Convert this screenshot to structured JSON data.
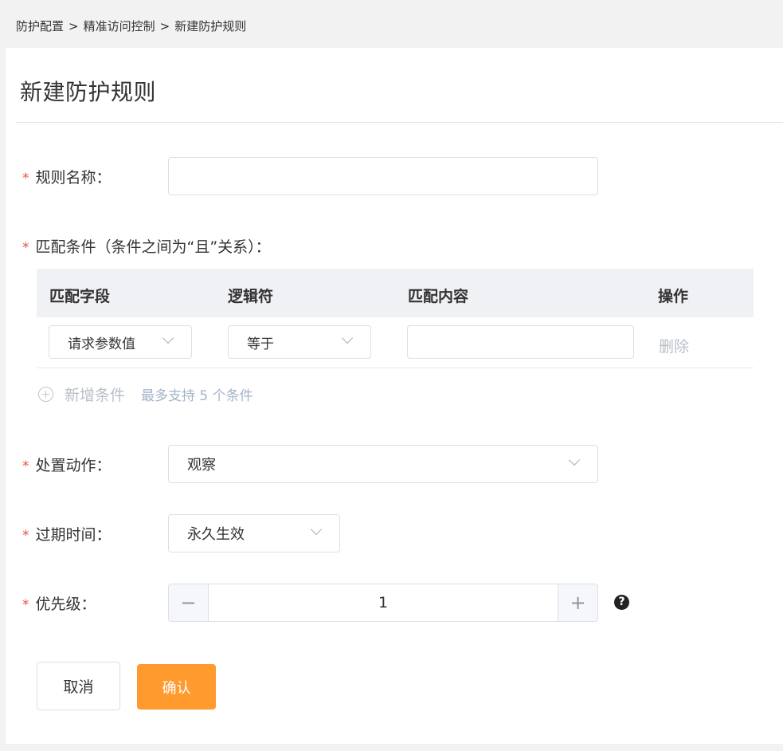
{
  "breadcrumb": {
    "items": [
      "防护配置",
      "精准访问控制",
      "新建防护规则"
    ],
    "separator": ">"
  },
  "page": {
    "title": "新建防护规则"
  },
  "form": {
    "required_mark": "*",
    "rule_name": {
      "label": "规则名称：",
      "value": ""
    },
    "conditions": {
      "label": "匹配条件（条件之间为“且”关系）：",
      "columns": [
        "匹配字段",
        "逻辑符",
        "匹配内容",
        "操作"
      ],
      "rows": [
        {
          "field": "请求参数值",
          "logic": "等于",
          "content": "",
          "action": "删除"
        }
      ],
      "add_label": "新增条件",
      "add_hint": "最多支持 5 个条件"
    },
    "action": {
      "label": "处置动作：",
      "value": "观察"
    },
    "expire": {
      "label": "过期时间：",
      "value": "永久生效"
    },
    "priority": {
      "label": "优先级：",
      "value": "1",
      "minus": "−",
      "plus": "+",
      "help": "?"
    }
  },
  "buttons": {
    "cancel": "取消",
    "confirm": "确认"
  },
  "colors": {
    "accent": "#ff9a2e",
    "required": "#f04d3f",
    "table_header_bg": "#f0f1f5",
    "disabled_text": "#b8bec9",
    "hint_text": "#a4b3c9"
  }
}
